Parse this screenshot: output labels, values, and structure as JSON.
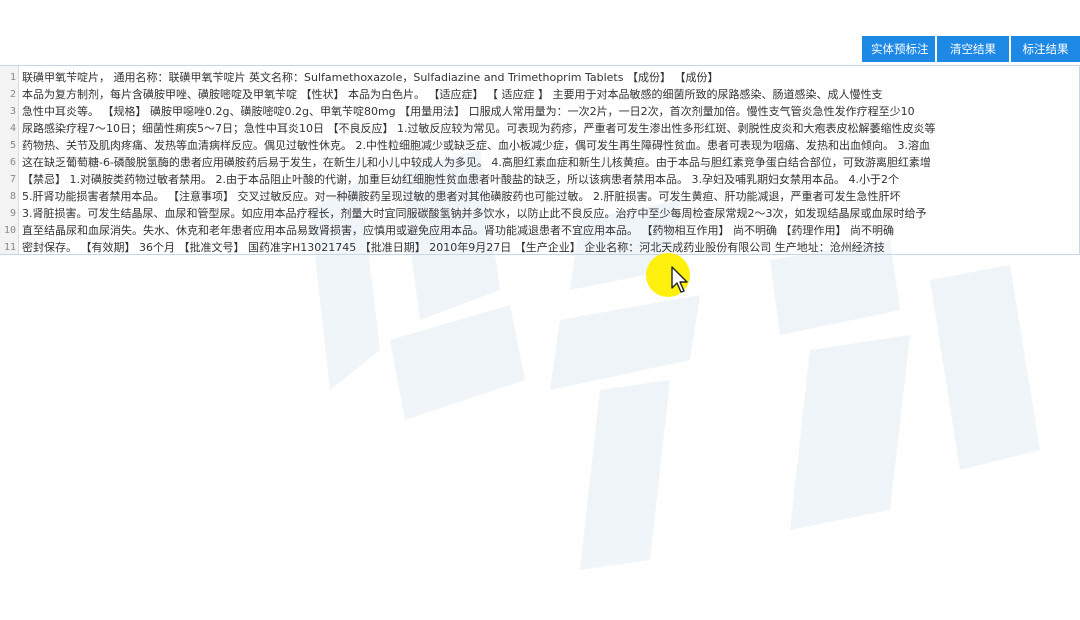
{
  "toolbar": {
    "buttons": [
      "实体预标注",
      "清空结果",
      "标注结果"
    ]
  },
  "editor": {
    "lines": [
      {
        "num": "1",
        "text": "联磺甲氧苄啶片，    通用名称：联磺甲氧苄啶片    英文名称：Sulfamethoxazole，Sulfadiazine   and   Trimethoprim   Tablets   【成份】   【成份】"
      },
      {
        "num": "2",
        "text": "本品为复方制剂，每片含磺胺甲唑、磺胺嘧啶及甲氧苄啶  【性状】   本品为白色片。    【适应症】    【   适应症   】    主要用于对本品敏感的细菌所致的尿路感染、肠道感染、成人慢性支"
      },
      {
        "num": "3",
        "text": "急性中耳炎等。    【规格】    磺胺甲噁唑0.2g、磺胺嘧啶0.2g、甲氧苄啶80mg   【用量用法】    口服成人常用量为：一次2片，一日2次，首次剂量加倍。慢性支气管炎急性发作疗程至少10"
      },
      {
        "num": "4",
        "text": "尿路感染疗程7～10日；细菌性痢疾5～7日；急性中耳炎10日   【不良反应】    1.过敏反应较为常见。可表现为药疹，严重者可发生渗出性多形红斑、剥脱性皮炎和大疱表皮松解萎缩性皮炎等"
      },
      {
        "num": "5",
        "text": "药物热、关节及肌肉疼痛、发热等血清病样反应。偶见过敏性休克。    2.中性粒细胞减少或缺乏症、血小板减少症，偶可发生再生障碍性贫血。患者可表现为咽痛、发热和出血倾向。    3.溶血"
      },
      {
        "num": "6",
        "text": "这在缺乏葡萄糖-6-磷酸脱氢酶的患者应用磺胺药后易于发生，在新生儿和小儿中较成人为多见。    4.高胆红素血症和新生儿核黄疸。由于本品与胆红素竞争蛋白结合部位，可致游离胆红素增"
      },
      {
        "num": "7",
        "text": "    【禁忌】   1.对磺胺类药物过敏者禁用。    2.由于本品阻止叶酸的代谢，加重巨幼红细胞性贫血患者叶酸盐的缺乏，所以该病患者禁用本品。    3.孕妇及哺乳期妇女禁用本品。    4.小于2个"
      },
      {
        "num": "8",
        "text": "    5.肝肾功能损害者禁用本品。    【注意事项】    交叉过敏反应。对一种磺胺药呈现过敏的患者对其他磺胺药也可能过敏。    2.肝脏损害。可发生黄疸、肝功能减退，严重者可发生急性肝坏"
      },
      {
        "num": "9",
        "text": "    3.肾脏损害。可发生结晶尿、血尿和管型尿。如应用本品疗程长，剂量大时宜同服碳酸氢钠并多饮水，以防止此不良反应。治疗中至少每周检查尿常规2～3次，如发现结晶尿或血尿时给予"
      },
      {
        "num": "10",
        "text": "直至结晶尿和血尿消失。失水、休克和老年患者应用本品易致肾损害，应慎用或避免应用本品。肾功能减退患者不宜应用本品。    【药物相互作用】    尚不明确    【药理作用】    尚不明确"
      },
      {
        "num": "11",
        "text": "密封保存。    【有效期】    36个月    【批准文号】    国药准字H13021745    【批准日期】    2010年9月27日    【生产企业】    企业名称：河北天成药业股份有限公司    生产地址：沧州经济技"
      }
    ]
  },
  "colors": {
    "button_bg": "#1e88e5",
    "cursor_highlight": "#ffef00",
    "watermark": "#2f6db4"
  },
  "icons": {
    "cursor": "mouse-pointer-icon",
    "watermark": "watermark-logo"
  }
}
